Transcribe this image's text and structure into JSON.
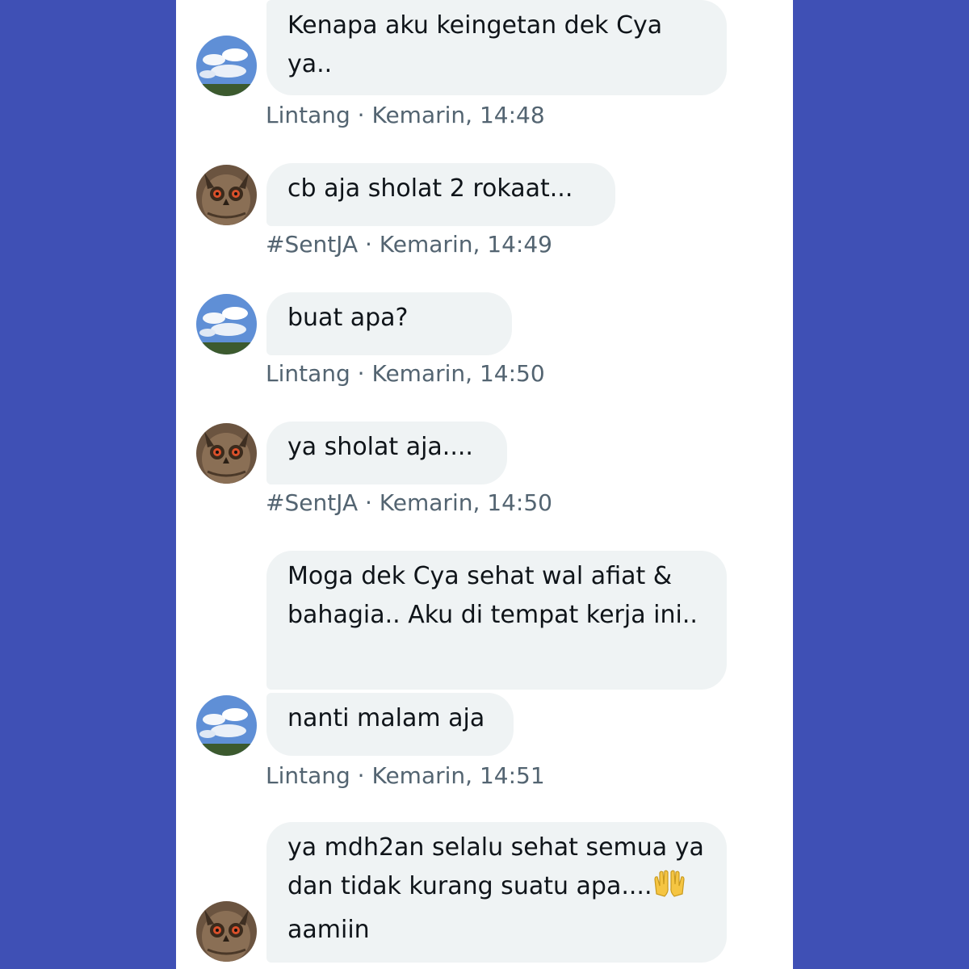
{
  "messages": [
    {
      "text": "Kenapa aku keingetan dek Cya ya..",
      "meta": "Lintang · Kemarin, 14:48"
    },
    {
      "text": "cb aja sholat 2 rokaat...",
      "meta": "#SentJA · Kemarin, 14:49"
    },
    {
      "text": "buat apa?",
      "meta": "Lintang · Kemarin, 14:50"
    },
    {
      "text": "ya sholat aja....",
      "meta": "#SentJA · Kemarin, 14:50"
    },
    {
      "text": "Moga dek Cya sehat wal afiat & bahagia.. Aku di tempat kerja ini.."
    },
    {
      "text": "nanti malam aja",
      "meta": "Lintang · Kemarin, 14:51"
    },
    {
      "text_before": "ya mdh2an selalu sehat semua ya dan tidak kurang suatu apa....",
      "emoji": "raising-hands-emoji",
      "text_after": " aamiin"
    }
  ],
  "avatars": {
    "lintang": "sky-clouds-avatar",
    "sentja": "owl-avatar"
  },
  "colors": {
    "background": "#3f50b5",
    "panel": "#ffffff",
    "bubble": "#eff3f4",
    "text": "#0f1419",
    "meta": "#536471"
  }
}
